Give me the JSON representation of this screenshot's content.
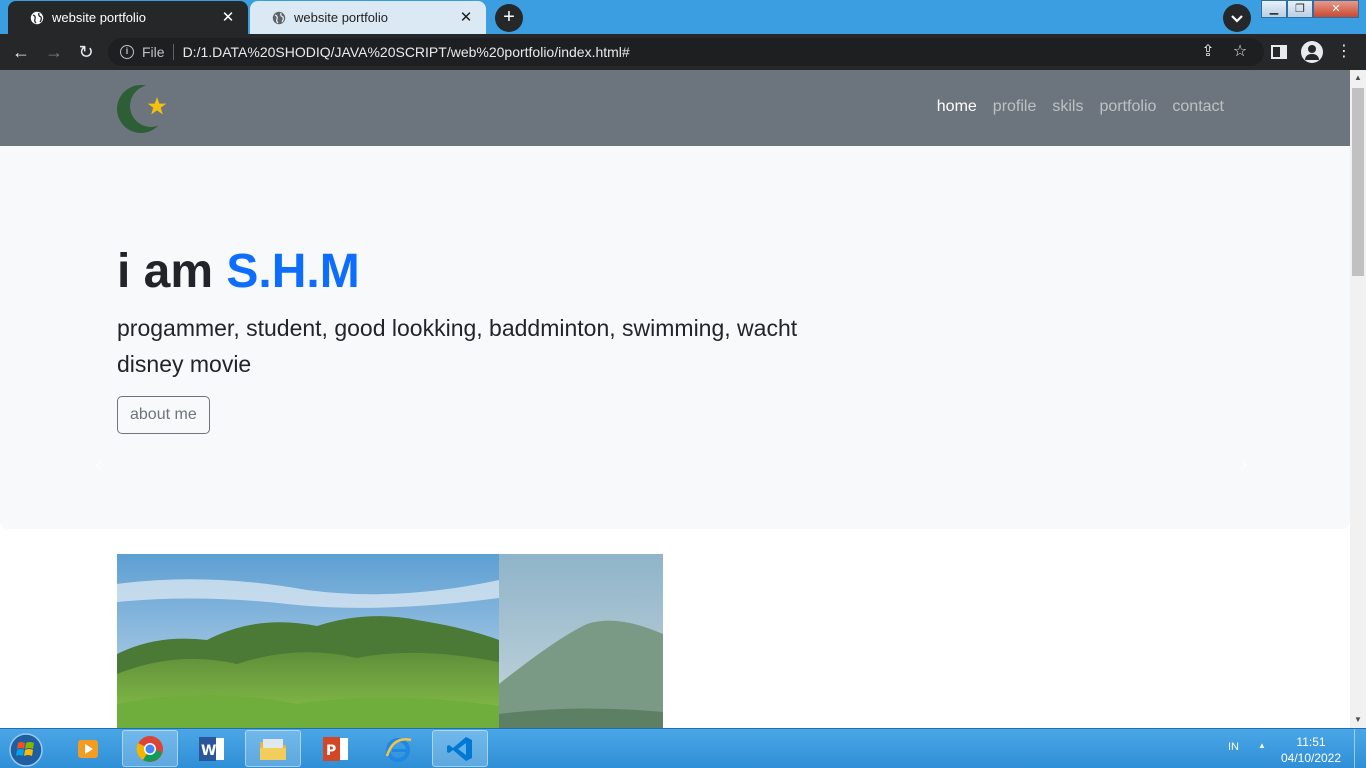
{
  "browser": {
    "tabs": [
      {
        "title": "website portfolio",
        "active": true
      },
      {
        "title": "website portfolio",
        "active": false
      }
    ],
    "new_tab_label": "+",
    "address": {
      "chip": "File",
      "url": "D:/1.DATA%20SHODIQ/JAVA%20SCRIPT/web%20portfolio/index.html#"
    }
  },
  "site": {
    "nav": {
      "links": [
        "home",
        "profile",
        "skils",
        "portfolio",
        "contact"
      ],
      "active": "home"
    },
    "hero": {
      "title_prefix": "i am ",
      "title_name": "S.H.M",
      "subtitle": "progammer, student, good lookking, baddminton, swimming, wacht disney movie",
      "button": "about me"
    },
    "colors": {
      "navbar": "#6c757d",
      "accent": "#0d6efd",
      "hero_bg": "#f8f9fa",
      "logo_crescent": "#2e5e36",
      "logo_star": "#f4c20d"
    }
  },
  "taskbar": {
    "apps": [
      "windows-media-player-icon",
      "chrome-icon",
      "word-icon",
      "file-explorer-icon",
      "powerpoint-icon",
      "internet-explorer-icon",
      "vscode-icon"
    ],
    "language": "IN",
    "time": "11:51",
    "date": "04/10/2022"
  }
}
